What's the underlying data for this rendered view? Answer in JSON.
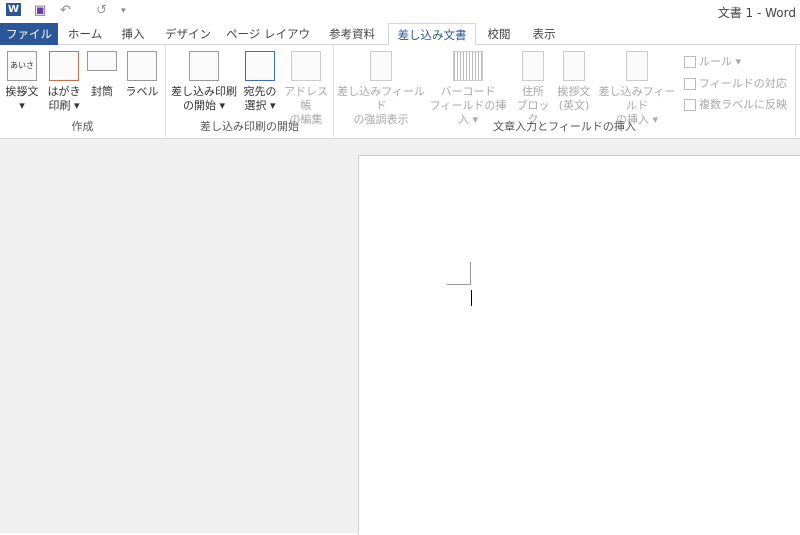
{
  "titlebar": {
    "title": "文書 1 - Word",
    "qa_icons": [
      "word-logo-icon",
      "save-icon",
      "undo-icon",
      "redo-icon",
      "customize-icon"
    ]
  },
  "tabs": [
    "ファイル",
    "ホーム",
    "挿入",
    "デザイン",
    "ページ レイアウト",
    "参考資料",
    "差し込み文書",
    "校閲",
    "表示"
  ],
  "ribbon": {
    "groups": [
      {
        "label": "作成",
        "buttons": [
          {
            "l1": "挨拶文",
            "l2": "▾"
          },
          {
            "l1": "はがき",
            "l2": "印刷 ▾"
          },
          {
            "l1": "封筒",
            "l2": ""
          },
          {
            "l1": "ラベル",
            "l2": ""
          }
        ]
      },
      {
        "label": "差し込み印刷の開始",
        "buttons": [
          {
            "l1": "差し込み印刷",
            "l2": "の開始 ▾"
          },
          {
            "l1": "宛先の",
            "l2": "選択 ▾"
          },
          {
            "l1": "アドレス帳",
            "l2": "の編集"
          }
        ]
      },
      {
        "label": "文章入力とフィールドの挿入",
        "buttons": [
          {
            "l1": "差し込みフィールド",
            "l2": "の強調表示"
          },
          {
            "l1": "バーコード",
            "l2": "フィールドの挿入 ▾"
          },
          {
            "l1": "住所",
            "l2": "ブロック"
          },
          {
            "l1": "挨拶文",
            "l2": "(英文)"
          },
          {
            "l1": "差し込みフィールド",
            "l2": "の挿入 ▾"
          }
        ],
        "small": [
          "ルール ▾",
          "フィールドの対応",
          "複数ラベルに反映"
        ]
      }
    ]
  },
  "icon_text": "あいさつ"
}
